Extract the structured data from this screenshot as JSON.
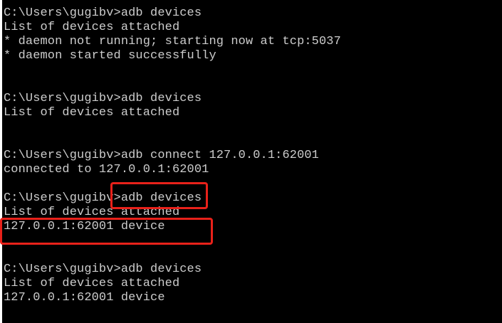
{
  "terminal": {
    "lines": [
      "C:\\Users\\gugibv>adb devices",
      "List of devices attached",
      "* daemon not running; starting now at tcp:5037",
      "* daemon started successfully",
      "",
      "",
      "C:\\Users\\gugibv>adb devices",
      "List of devices attached",
      "",
      "",
      "C:\\Users\\gugibv>adb connect 127.0.0.1:62001",
      "connected to 127.0.0.1:62001",
      "",
      "C:\\Users\\gugibv>adb devices",
      "List of devices attached",
      "127.0.0.1:62001 device",
      "",
      "",
      "C:\\Users\\gugibv>adb devices",
      "List of devices attached",
      "127.0.0.1:62001 device"
    ]
  },
  "annotations": {
    "highlight_color": "#e8211a"
  }
}
